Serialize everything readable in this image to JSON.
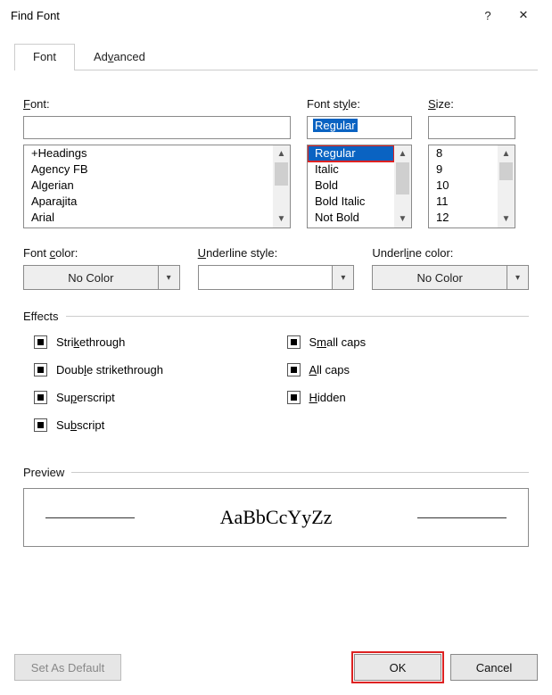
{
  "title": "Find Font",
  "tabs": [
    {
      "label": "Font",
      "active": true
    },
    {
      "label": "Advanced",
      "active": false
    }
  ],
  "font": {
    "label": "Font:",
    "value": "",
    "items": [
      "+Headings",
      "Agency FB",
      "Algerian",
      "Aparajita",
      "Arial"
    ]
  },
  "style": {
    "label": "Font style:",
    "value": "Regular",
    "selectedIndex": 0,
    "items": [
      "Regular",
      "Italic",
      "Bold",
      "Bold Italic",
      "Not Bold"
    ]
  },
  "size": {
    "label": "Size:",
    "value": "",
    "items": [
      "8",
      "9",
      "10",
      "11",
      "12"
    ]
  },
  "fontColor": {
    "label": "Font color:",
    "value": "No Color"
  },
  "underlineStyle": {
    "label": "Underline style:",
    "value": ""
  },
  "underlineColor": {
    "label": "Underline color:",
    "value": "No Color"
  },
  "sections": {
    "effects": "Effects",
    "preview": "Preview"
  },
  "effects": {
    "left": [
      "Strikethrough",
      "Double strikethrough",
      "Superscript",
      "Subscript"
    ],
    "right": [
      "Small caps",
      "All caps",
      "Hidden"
    ],
    "state": "indeterminate"
  },
  "preview": {
    "sample": "AaBbCcYyZz"
  },
  "buttons": {
    "setDefault": "Set As Default",
    "ok": "OK",
    "cancel": "Cancel"
  },
  "highlighted": [
    "style.items.0",
    "buttons.ok"
  ]
}
